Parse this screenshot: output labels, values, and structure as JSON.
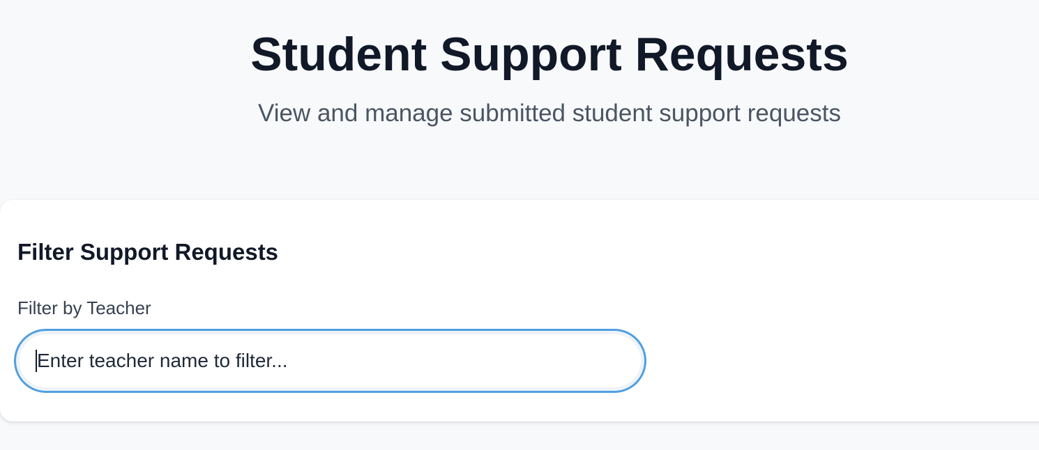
{
  "header": {
    "title": "Student Support Requests",
    "subtitle": "View and manage submitted student support requests"
  },
  "filter": {
    "heading": "Filter Support Requests",
    "teacher_label": "Filter by Teacher",
    "teacher_placeholder": "Enter teacher name to filter...",
    "teacher_value": ""
  },
  "colors": {
    "background": "#f8f9fb",
    "focus_ring": "#4f9fe0",
    "title_text": "#111827",
    "subtitle_text": "#4b5563"
  }
}
